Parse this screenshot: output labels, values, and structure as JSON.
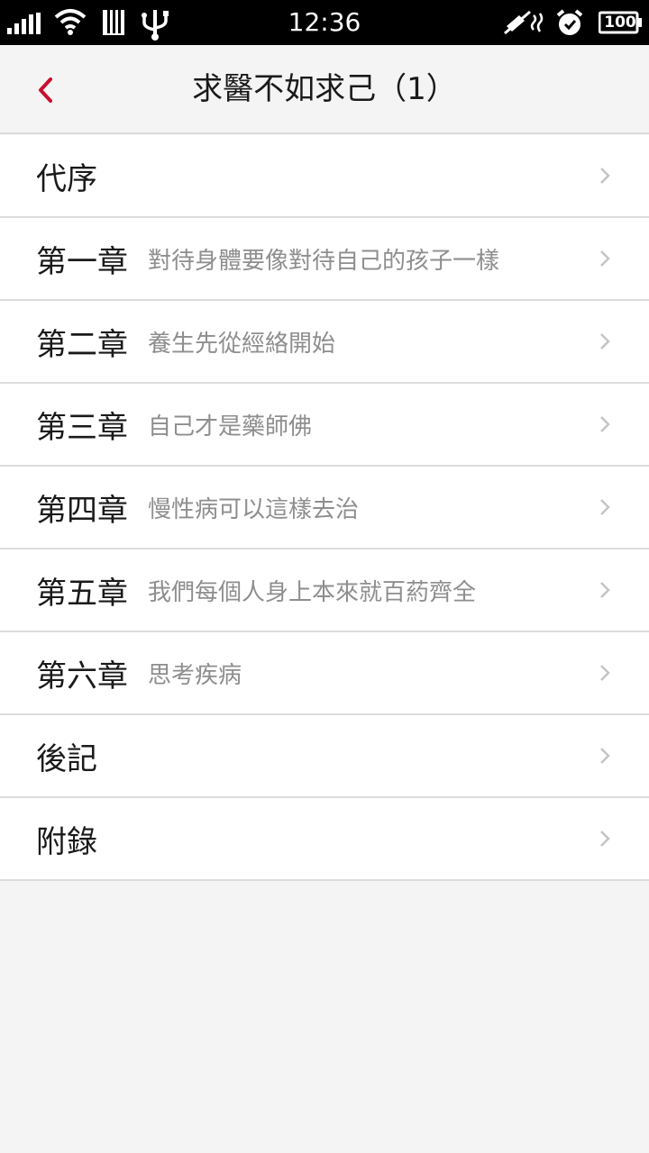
{
  "status_bar": {
    "time": "12:36",
    "battery": "100",
    "icons": [
      "signal-icon",
      "wifi-icon",
      "sd-card-icon",
      "usb-icon",
      "vibrate-icon",
      "alarm-icon",
      "battery-icon"
    ]
  },
  "header": {
    "title": "求醫不如求己（1）",
    "back_icon": "chevron-left-icon",
    "accent_color": "#c8102e"
  },
  "chapters": [
    {
      "label": "代序",
      "subtitle": ""
    },
    {
      "label": "第一章",
      "subtitle": "對待身體要像對待自己的孩子一樣"
    },
    {
      "label": "第二章",
      "subtitle": "養生先從經絡開始"
    },
    {
      "label": "第三章",
      "subtitle": "自己才是藥師佛"
    },
    {
      "label": "第四章",
      "subtitle": "慢性病可以這樣去治"
    },
    {
      "label": "第五章",
      "subtitle": "我們每個人身上本來就百葯齊全"
    },
    {
      "label": "第六章",
      "subtitle": "思考疾病"
    },
    {
      "label": "後記",
      "subtitle": ""
    },
    {
      "label": "附錄",
      "subtitle": ""
    }
  ]
}
